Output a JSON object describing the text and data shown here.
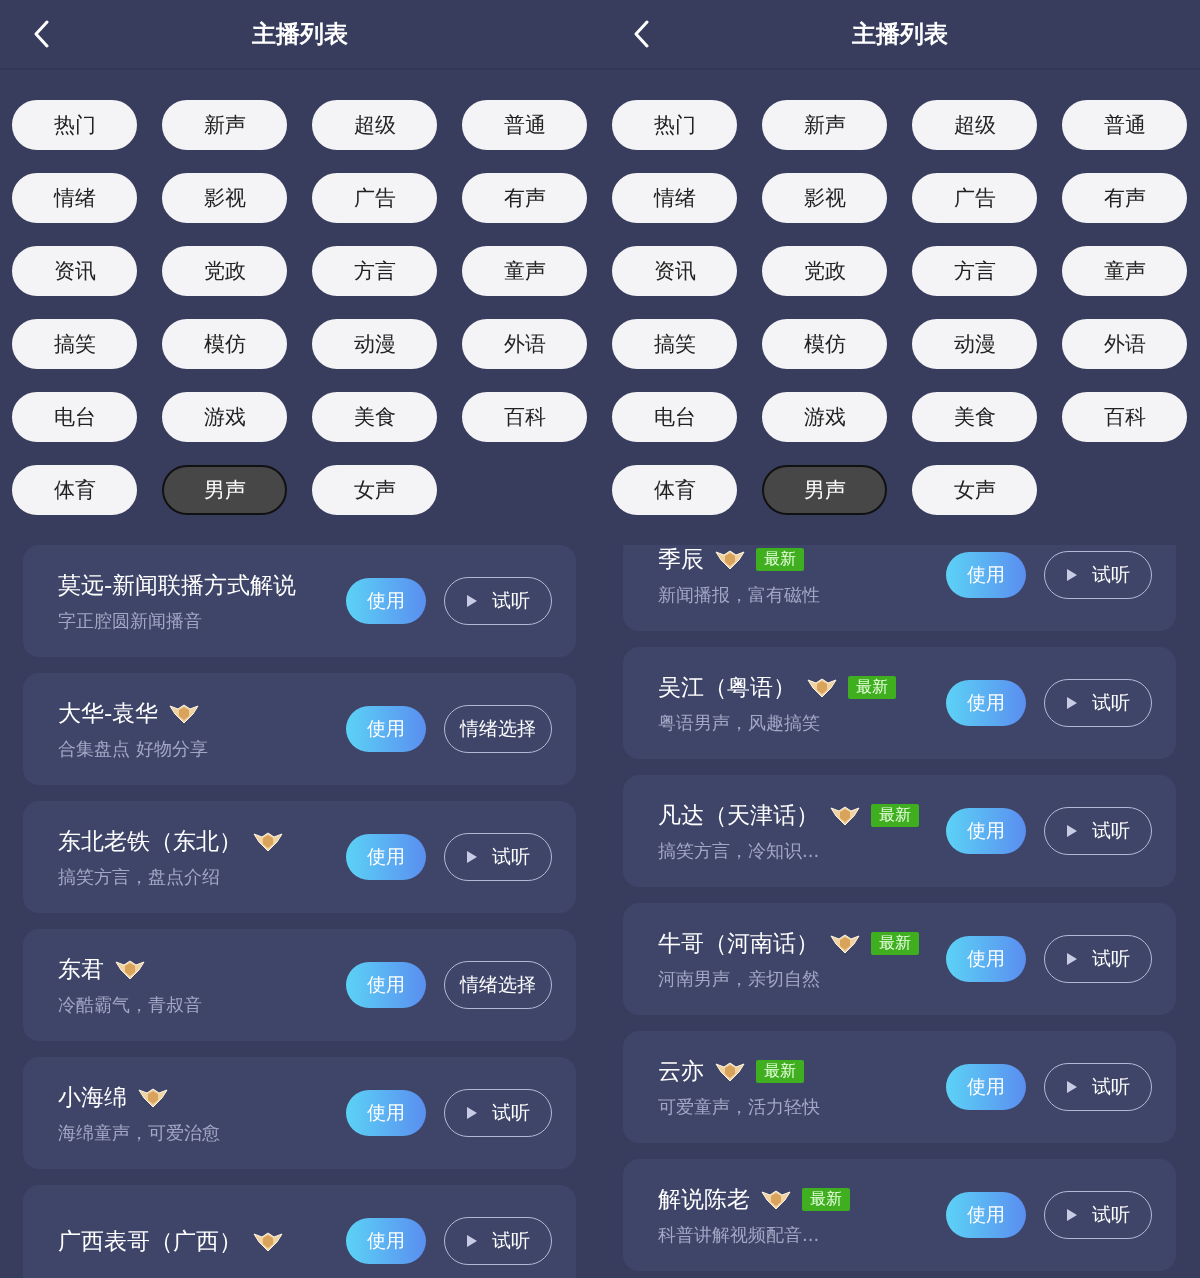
{
  "screens": [
    {
      "title": "主播列表",
      "tags": [
        {
          "label": "热门",
          "selected": false
        },
        {
          "label": "新声",
          "selected": false
        },
        {
          "label": "超级",
          "selected": false
        },
        {
          "label": "普通",
          "selected": false
        },
        {
          "label": "情绪",
          "selected": false
        },
        {
          "label": "影视",
          "selected": false
        },
        {
          "label": "广告",
          "selected": false
        },
        {
          "label": "有声",
          "selected": false
        },
        {
          "label": "资讯",
          "selected": false
        },
        {
          "label": "党政",
          "selected": false
        },
        {
          "label": "方言",
          "selected": false
        },
        {
          "label": "童声",
          "selected": false
        },
        {
          "label": "搞笑",
          "selected": false
        },
        {
          "label": "模仿",
          "selected": false
        },
        {
          "label": "动漫",
          "selected": false
        },
        {
          "label": "外语",
          "selected": false
        },
        {
          "label": "电台",
          "selected": false
        },
        {
          "label": "游戏",
          "selected": false
        },
        {
          "label": "美食",
          "selected": false
        },
        {
          "label": "百科",
          "selected": false
        },
        {
          "label": "体育",
          "selected": false
        },
        {
          "label": "男声",
          "selected": true
        },
        {
          "label": "女声",
          "selected": false
        }
      ],
      "voices": [
        {
          "name": "莫远-新闻联播方式解说",
          "subtitle": "字正腔圆新闻播音",
          "badge": false,
          "use": "使用",
          "action": {
            "kind": "preview",
            "label": "试听"
          }
        },
        {
          "name": "大华-袁华",
          "subtitle": "合集盘点 好物分享",
          "badge": true,
          "use": "使用",
          "action": {
            "kind": "emotion",
            "label": "情绪选择"
          }
        },
        {
          "name": "东北老铁（东北）",
          "subtitle": "搞笑方言，盘点介绍",
          "badge": true,
          "use": "使用",
          "action": {
            "kind": "preview",
            "label": "试听"
          }
        },
        {
          "name": "东君",
          "subtitle": "冷酷霸气，青叔音",
          "badge": true,
          "use": "使用",
          "action": {
            "kind": "emotion",
            "label": "情绪选择"
          }
        },
        {
          "name": "小海绵",
          "subtitle": "海绵童声，可爱治愈",
          "badge": true,
          "use": "使用",
          "action": {
            "kind": "preview",
            "label": "试听"
          }
        },
        {
          "name": "广西表哥（广西）",
          "badge": true,
          "use": "使用",
          "action": {
            "kind": "preview",
            "label": "试听"
          }
        }
      ]
    },
    {
      "title": "主播列表",
      "scrolled": true,
      "tags": [
        {
          "label": "热门",
          "selected": false
        },
        {
          "label": "新声",
          "selected": false
        },
        {
          "label": "超级",
          "selected": false
        },
        {
          "label": "普通",
          "selected": false
        },
        {
          "label": "情绪",
          "selected": false
        },
        {
          "label": "影视",
          "selected": false
        },
        {
          "label": "广告",
          "selected": false
        },
        {
          "label": "有声",
          "selected": false
        },
        {
          "label": "资讯",
          "selected": false
        },
        {
          "label": "党政",
          "selected": false
        },
        {
          "label": "方言",
          "selected": false
        },
        {
          "label": "童声",
          "selected": false
        },
        {
          "label": "搞笑",
          "selected": false
        },
        {
          "label": "模仿",
          "selected": false
        },
        {
          "label": "动漫",
          "selected": false
        },
        {
          "label": "外语",
          "selected": false
        },
        {
          "label": "电台",
          "selected": false
        },
        {
          "label": "游戏",
          "selected": false
        },
        {
          "label": "美食",
          "selected": false
        },
        {
          "label": "百科",
          "selected": false
        },
        {
          "label": "体育",
          "selected": false
        },
        {
          "label": "男声",
          "selected": true
        },
        {
          "label": "女声",
          "selected": false
        }
      ],
      "voices": [
        {
          "name": "季辰",
          "subtitle": "新闻播报，富有磁性",
          "badge": true,
          "new_tag": "最新",
          "use": "使用",
          "action": {
            "kind": "preview",
            "label": "试听"
          }
        },
        {
          "name": "吴江（粤语）",
          "subtitle": "粤语男声，风趣搞笑",
          "badge": true,
          "new_tag": "最新",
          "use": "使用",
          "action": {
            "kind": "preview",
            "label": "试听"
          }
        },
        {
          "name": "凡达（天津话）",
          "subtitle": "搞笑方言，冷知识...",
          "badge": true,
          "new_tag": "最新",
          "use": "使用",
          "action": {
            "kind": "preview",
            "label": "试听"
          }
        },
        {
          "name": "牛哥（河南话）",
          "subtitle": "河南男声，亲切自然",
          "badge": true,
          "new_tag": "最新",
          "use": "使用",
          "action": {
            "kind": "preview",
            "label": "试听"
          }
        },
        {
          "name": "云亦",
          "subtitle": "可爱童声，活力轻快",
          "badge": true,
          "new_tag": "最新",
          "use": "使用",
          "action": {
            "kind": "preview",
            "label": "试听"
          }
        },
        {
          "name": "解说陈老",
          "subtitle": "科普讲解视频配音...",
          "badge": true,
          "new_tag": "最新",
          "use": "使用",
          "action": {
            "kind": "preview",
            "label": "试听"
          }
        }
      ]
    }
  ]
}
